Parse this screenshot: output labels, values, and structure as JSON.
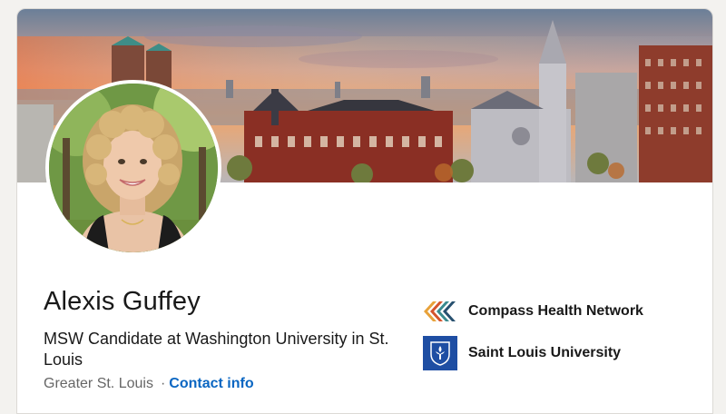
{
  "profile": {
    "name": "Alexis Guffey",
    "headline": "MSW Candidate at Washington University in St. Louis",
    "location": "Greater St. Louis",
    "separator": "·",
    "contact_label": "Contact info"
  },
  "organizations": [
    {
      "name": "Compass Health Network",
      "icon": "compass-health-logo"
    },
    {
      "name": "Saint Louis University",
      "icon": "slu-shield-logo"
    }
  ],
  "colors": {
    "link": "#0a66c2",
    "text_primary": "#191919",
    "text_secondary": "#666666",
    "slu_blue": "#1e4ea3"
  }
}
